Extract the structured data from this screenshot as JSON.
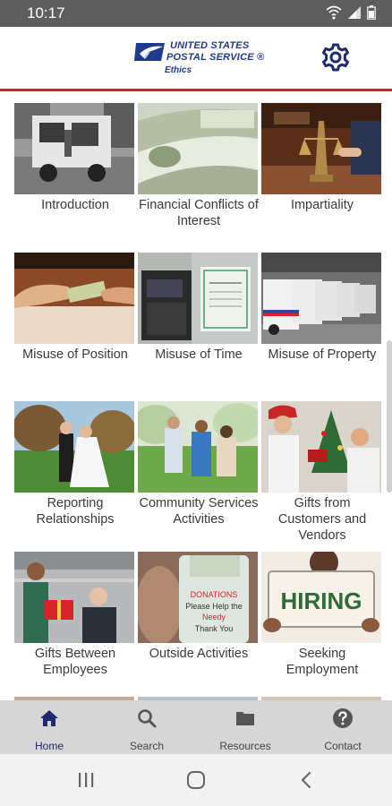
{
  "status_bar": {
    "time": "10:17"
  },
  "header": {
    "logo_line1": "UNITED STATES",
    "logo_line2": "POSTAL SERVICE ®",
    "logo_sub": "Ethics"
  },
  "tiles": [
    {
      "label": "Introduction"
    },
    {
      "label": "Financial Conflicts of Interest"
    },
    {
      "label": "Impartiality"
    },
    {
      "label": "Misuse of Position"
    },
    {
      "label": "Misuse of Time"
    },
    {
      "label": "Misuse of Property"
    },
    {
      "label": "Reporting Relationships"
    },
    {
      "label": "Community Services Activities"
    },
    {
      "label": "Gifts from Customers and Vendors"
    },
    {
      "label": "Gifts Between Employees"
    },
    {
      "label": "Outside Activities"
    },
    {
      "label": "Seeking Employment"
    }
  ],
  "image_text": {
    "donations_line1": "DONATIONS",
    "donations_line2": "Please Help the",
    "donations_line3": "Needy",
    "donations_line4": "Thank You",
    "hiring": "HIRING"
  },
  "bottom_nav": {
    "home": "Home",
    "search": "Search",
    "resources": "Resources",
    "contact": "Contact"
  },
  "colors": {
    "brand_blue": "#1f3a8a",
    "accent_red": "#d8232a",
    "nav_bg": "#d6d6d6"
  }
}
